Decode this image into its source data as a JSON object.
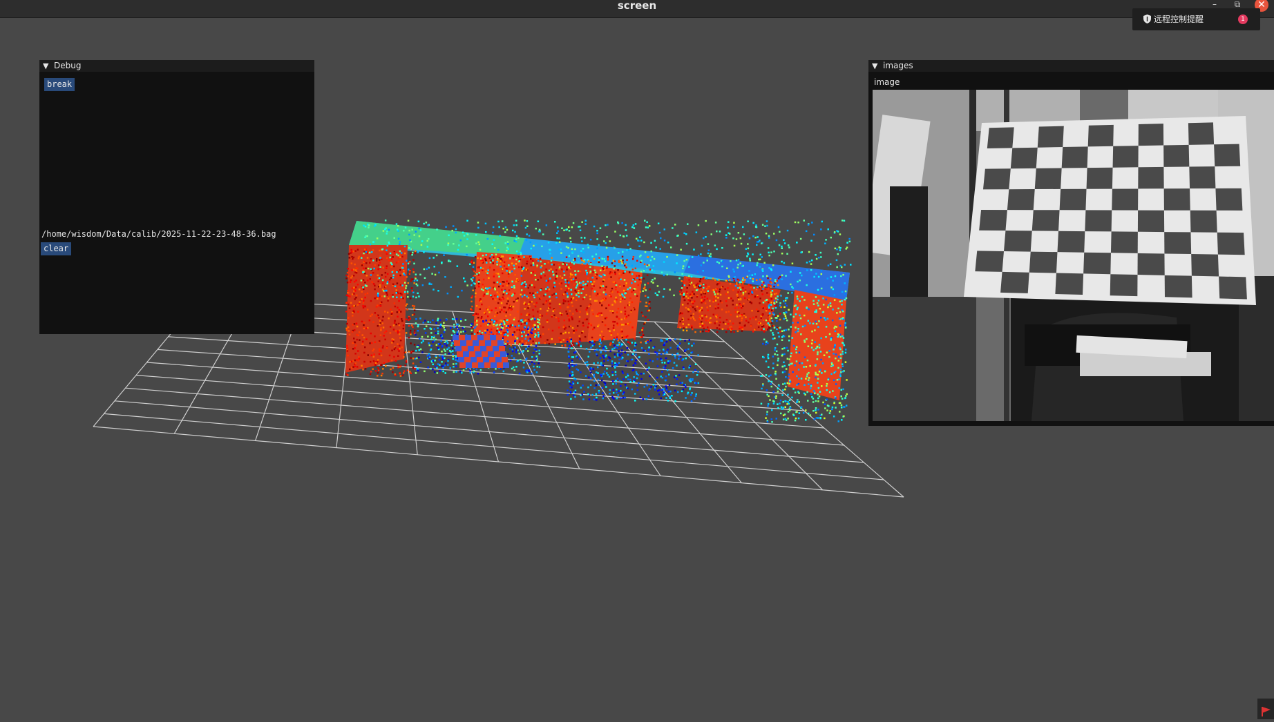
{
  "window": {
    "title": "screen",
    "minimize_icon": "minimize-icon",
    "restore_icon": "restore-icon",
    "close_icon": "close-icon"
  },
  "notification": {
    "text": "远程控制提醒",
    "badge": "1",
    "icon": "shield-icon"
  },
  "debug_panel": {
    "title": "Debug",
    "break_label": "break",
    "bag_path": "/home/wisdom/Data/calib/2025-11-22-23-48-36.bag",
    "clear_label": "clear"
  },
  "images_panel": {
    "title": "images",
    "image_label": "image"
  },
  "colors": {
    "background": "#484848",
    "panel": "#111111",
    "button": "#294a7a",
    "grid": "#d0d0d0",
    "close": "#e9543d",
    "badge": "#e43a5f"
  }
}
